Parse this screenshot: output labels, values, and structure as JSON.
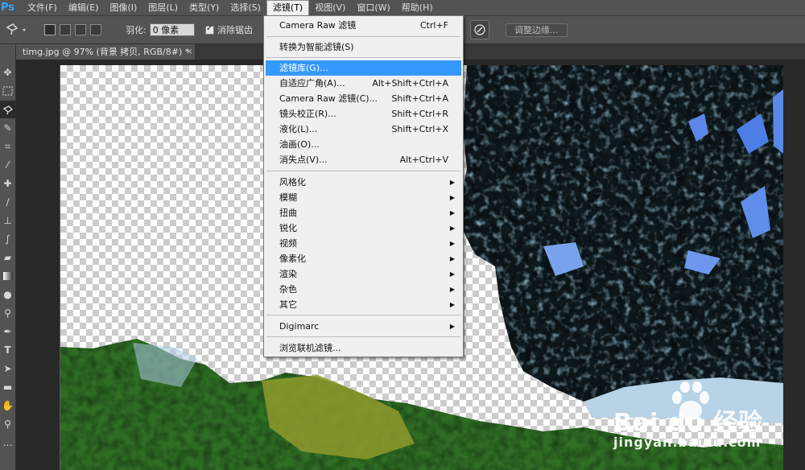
{
  "app": {
    "logo": "Ps"
  },
  "menubar": {
    "items": [
      "文件(F)",
      "编辑(E)",
      "图像(I)",
      "图层(L)",
      "类型(Y)",
      "选择(S)",
      "滤镜(T)",
      "视图(V)",
      "窗口(W)",
      "帮助(H)"
    ],
    "active_index": 6
  },
  "options": {
    "feather_label": "羽化:",
    "feather_value": "0 像素",
    "antialias_label": "消除锯齿",
    "antialias_checked": true,
    "refine_edge_label": "调整边缘..."
  },
  "document": {
    "tab_title": "timg.jpg @ 97% (背景 拷贝, RGB/8#) *",
    "close_glyph": "×"
  },
  "filter_menu": {
    "items": [
      {
        "label": "Camera Raw 滤镜",
        "shortcut": "Ctrl+F"
      },
      {
        "label": "转换为智能滤镜(S)",
        "shortcut": ""
      },
      {
        "label": "滤镜库(G)...",
        "shortcut": "",
        "highlighted": true
      },
      {
        "label": "自适应广角(A)...",
        "shortcut": "Alt+Shift+Ctrl+A"
      },
      {
        "label": "Camera Raw 滤镜(C)...",
        "shortcut": "Shift+Ctrl+A"
      },
      {
        "label": "镜头校正(R)...",
        "shortcut": "Shift+Ctrl+R"
      },
      {
        "label": "液化(L)...",
        "shortcut": "Shift+Ctrl+X"
      },
      {
        "label": "油画(O)...",
        "shortcut": ""
      },
      {
        "label": "消失点(V)...",
        "shortcut": "Alt+Ctrl+V"
      },
      {
        "label": "风格化",
        "submenu": true
      },
      {
        "label": "模糊",
        "submenu": true
      },
      {
        "label": "扭曲",
        "submenu": true
      },
      {
        "label": "锐化",
        "submenu": true
      },
      {
        "label": "视频",
        "submenu": true
      },
      {
        "label": "像素化",
        "submenu": true
      },
      {
        "label": "渲染",
        "submenu": true
      },
      {
        "label": "杂色",
        "submenu": true
      },
      {
        "label": "其它",
        "submenu": true
      },
      {
        "label": "Digimarc",
        "submenu": true
      },
      {
        "label": "浏览联机滤镜..."
      }
    ]
  },
  "watermark": {
    "text": "Bai du 经验",
    "url": "jingyan.baidu.com"
  },
  "colors": {
    "ui_dark": "#535353",
    "menu_highlight": "#3399ff",
    "menu_bg": "#f0f0f0"
  }
}
